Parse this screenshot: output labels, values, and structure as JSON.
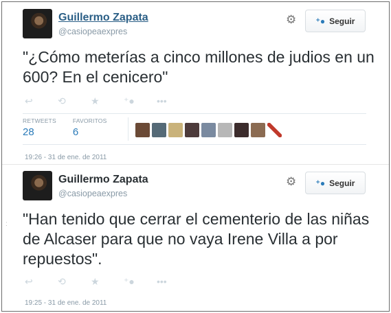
{
  "tweets": [
    {
      "author": "Guillermo Zapata",
      "handle": "@casiopeaexpres",
      "follow_label": "Seguir",
      "text": "\"¿Cómo meterías a cinco millones de judios en un 600? En el cenicero\"",
      "actions": [
        "reply-icon",
        "retweet-icon",
        "favorite-icon",
        "follow-icon",
        "more-icon"
      ],
      "retweets_label": "RETWEETS",
      "retweets_value": "28",
      "favorites_label": "FAVORITOS",
      "favorites_value": "6",
      "timestamp": "19:26 - 31 de ene. de 2011"
    },
    {
      "author": "Guillermo Zapata",
      "handle": "@casiopeaexpres",
      "follow_label": "Seguir",
      "text": "\"Han tenido que cerrar el cementerio de las niñas de Alcaser para que no vaya Irene Villa a por repuestos\".",
      "actions": [
        "reply-icon",
        "retweet-icon",
        "favorite-icon",
        "follow-icon",
        "more-icon"
      ],
      "timestamp": "19:25 - 31 de ene. de 2011"
    }
  ],
  "colors": {
    "link": "#2b7bb9",
    "text": "#292f33",
    "muted": "#8899a6"
  },
  "faces": [
    "#6b4a36",
    "#556a77",
    "#c9b27a",
    "#4d3b3b",
    "#7a8aa0",
    "#b7b7b7",
    "#3c2c2c",
    "#8b6b52",
    "#c0392b"
  ]
}
